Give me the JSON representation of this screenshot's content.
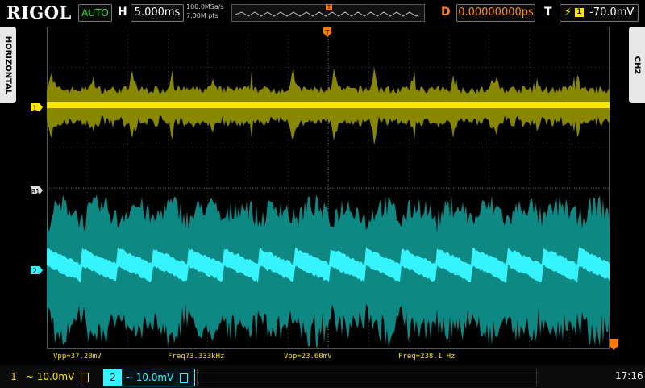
{
  "brand": "RIGOL",
  "top": {
    "run_state": "AUTO",
    "timebase_label": "H",
    "timebase_value": "5.000ms",
    "sample_rate": "100.0MSa/s",
    "memory_depth": "7.00M pts",
    "trigger_marker": "T",
    "delay_label": "D",
    "delay_value": "0.00000000ps",
    "trigger_label": "T",
    "trigger_source": "1",
    "trigger_level": "-70.0mV"
  },
  "side": {
    "left_tab": "HORIZONTAL",
    "right_tab": "CH2"
  },
  "markers": {
    "ch1": "1",
    "ref": "R1",
    "ch2": "2",
    "trig": "T"
  },
  "measurements": {
    "vpp1": "Vpp=37.20mV",
    "freq1": "Freq?3.333kHz",
    "vpp2": "Vpp=23.60mV",
    "freq2": "Freq=238.1 Hz"
  },
  "bottom": {
    "ch1_num": "1",
    "ch1_scale": "~ 10.0mV",
    "ch2_num": "2",
    "ch2_scale": "~ 10.0mV",
    "clock": "17:16"
  },
  "colors": {
    "ch1": "#ffe600",
    "ch1_dim": "#8f8f00",
    "ch2": "#36f4ff",
    "ch2_dim": "#0f8f8a",
    "accent": "#ff7a00"
  }
}
